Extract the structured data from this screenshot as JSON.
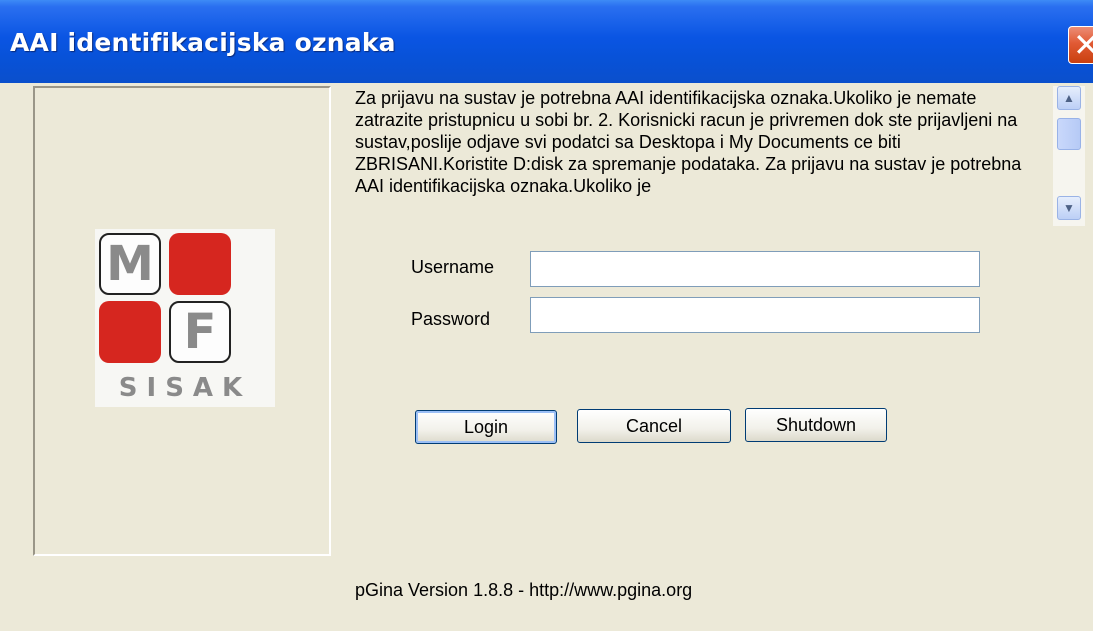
{
  "window": {
    "title": "AAI identifikacijska oznaka",
    "close_glyph": "✕"
  },
  "logo": {
    "letter_top": "M",
    "letter_bottom": "F",
    "word": "SISAK",
    "colors": {
      "red": "#d6261f",
      "gray": "#8a8a8a"
    }
  },
  "notice": {
    "text": "Za prijavu na sustav je potrebna AAI identifikacijska oznaka.Ukoliko je nemate zatrazite pristupnicu u sobi br. 2. Korisnicki racun je privremen dok ste prijavljeni na sustav,poslije odjave svi podatci sa Desktopa i My Documents ce biti ZBRISANI.Koristite D:disk za spremanje podataka. Za prijavu na sustav je potrebna AAI identifikacijska oznaka.Ukoliko je",
    "scroll_up_icon": "scroll-up-arrow",
    "scroll_down_icon": "scroll-down-arrow"
  },
  "form": {
    "username_label": "Username",
    "username_value": "",
    "password_label": "Password",
    "password_value": ""
  },
  "buttons": {
    "login": "Login",
    "cancel": "Cancel",
    "shutdown": "Shutdown"
  },
  "footer": {
    "version_text": "pGina Version 1.8.8 - http://www.pgina.org"
  },
  "colors": {
    "titlebar": "#0a55e3",
    "dialog_bg": "#ece9d8",
    "close_button": "#e15a34"
  }
}
